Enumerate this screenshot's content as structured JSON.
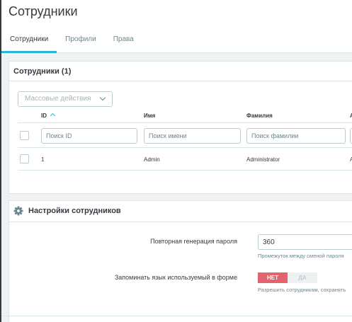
{
  "header": {
    "title": "Сотрудники",
    "tabs": [
      {
        "label": "Сотрудники",
        "active": true
      },
      {
        "label": "Профили",
        "active": false
      },
      {
        "label": "Права",
        "active": false
      }
    ]
  },
  "employees_panel": {
    "title": "Сотрудники (1)",
    "bulk_actions": "Массовые действия",
    "columns": [
      "ID",
      "Имя",
      "Фамилия",
      "A"
    ],
    "filters": {
      "id": "Поиск ID",
      "first_name": "Поиск имени",
      "last_name": "Поиск фамилии"
    },
    "rows": [
      {
        "id": "1",
        "first_name": "Admin",
        "last_name": "Administrator",
        "extra": "A"
      }
    ]
  },
  "settings_panel": {
    "title": "Настройки сотрудников",
    "password_regen_label": "Повторная генерация пароля",
    "password_regen_value": "360",
    "password_regen_help": "Промежуток между сменой пароля",
    "remember_lang_label": "Запоминать язык используемый в форме",
    "toggle_no": "НЕТ",
    "toggle_yes": "ДА",
    "remember_lang_value": "НЕТ",
    "remember_lang_help": "Разрешить сотрудникам, сохранять"
  },
  "colors": {
    "accent": "#25b9d7",
    "toggle_off": "#e3636e",
    "background": "#eff1f2"
  },
  "icons": [
    "sort-ascending-icon",
    "chevron-down-icon",
    "gear-icon"
  ]
}
